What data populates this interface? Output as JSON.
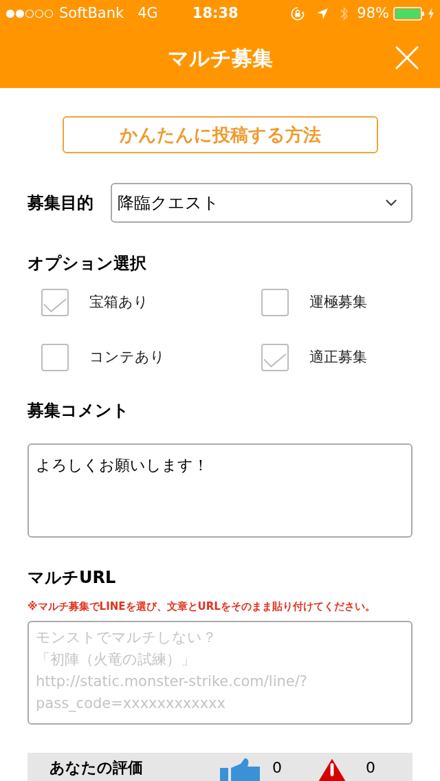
{
  "status_bar": {
    "carrier": "SoftBank",
    "network": "4G",
    "time": "18:38",
    "battery": "98%"
  },
  "nav": {
    "title": "マルチ募集"
  },
  "help_button": {
    "label": "かんたんに投稿する方法"
  },
  "purpose": {
    "label": "募集目的",
    "value": "降臨クエスト"
  },
  "options": {
    "heading": "オプション選択",
    "items": [
      {
        "label": "宝箱あり",
        "checked": true
      },
      {
        "label": "運極募集",
        "checked": false
      },
      {
        "label": "コンテあり",
        "checked": false
      },
      {
        "label": "適正募集",
        "checked": true
      }
    ]
  },
  "comment": {
    "heading": "募集コメント",
    "value": "よろしくお願いします！"
  },
  "multi_url": {
    "heading": "マルチURL",
    "note": "※マルチ募集でLINEを選び、文章とURLをそのまま貼り付けてください。",
    "placeholder": [
      "モンストでマルチしない？",
      "「初陣（火竜の試練）」",
      "http://static.monster-strike.com/line/?",
      "pass_code=xxxxxxxxxxxx"
    ]
  },
  "rating": {
    "label": "あなたの評価",
    "likes": "0",
    "reports": "0"
  }
}
